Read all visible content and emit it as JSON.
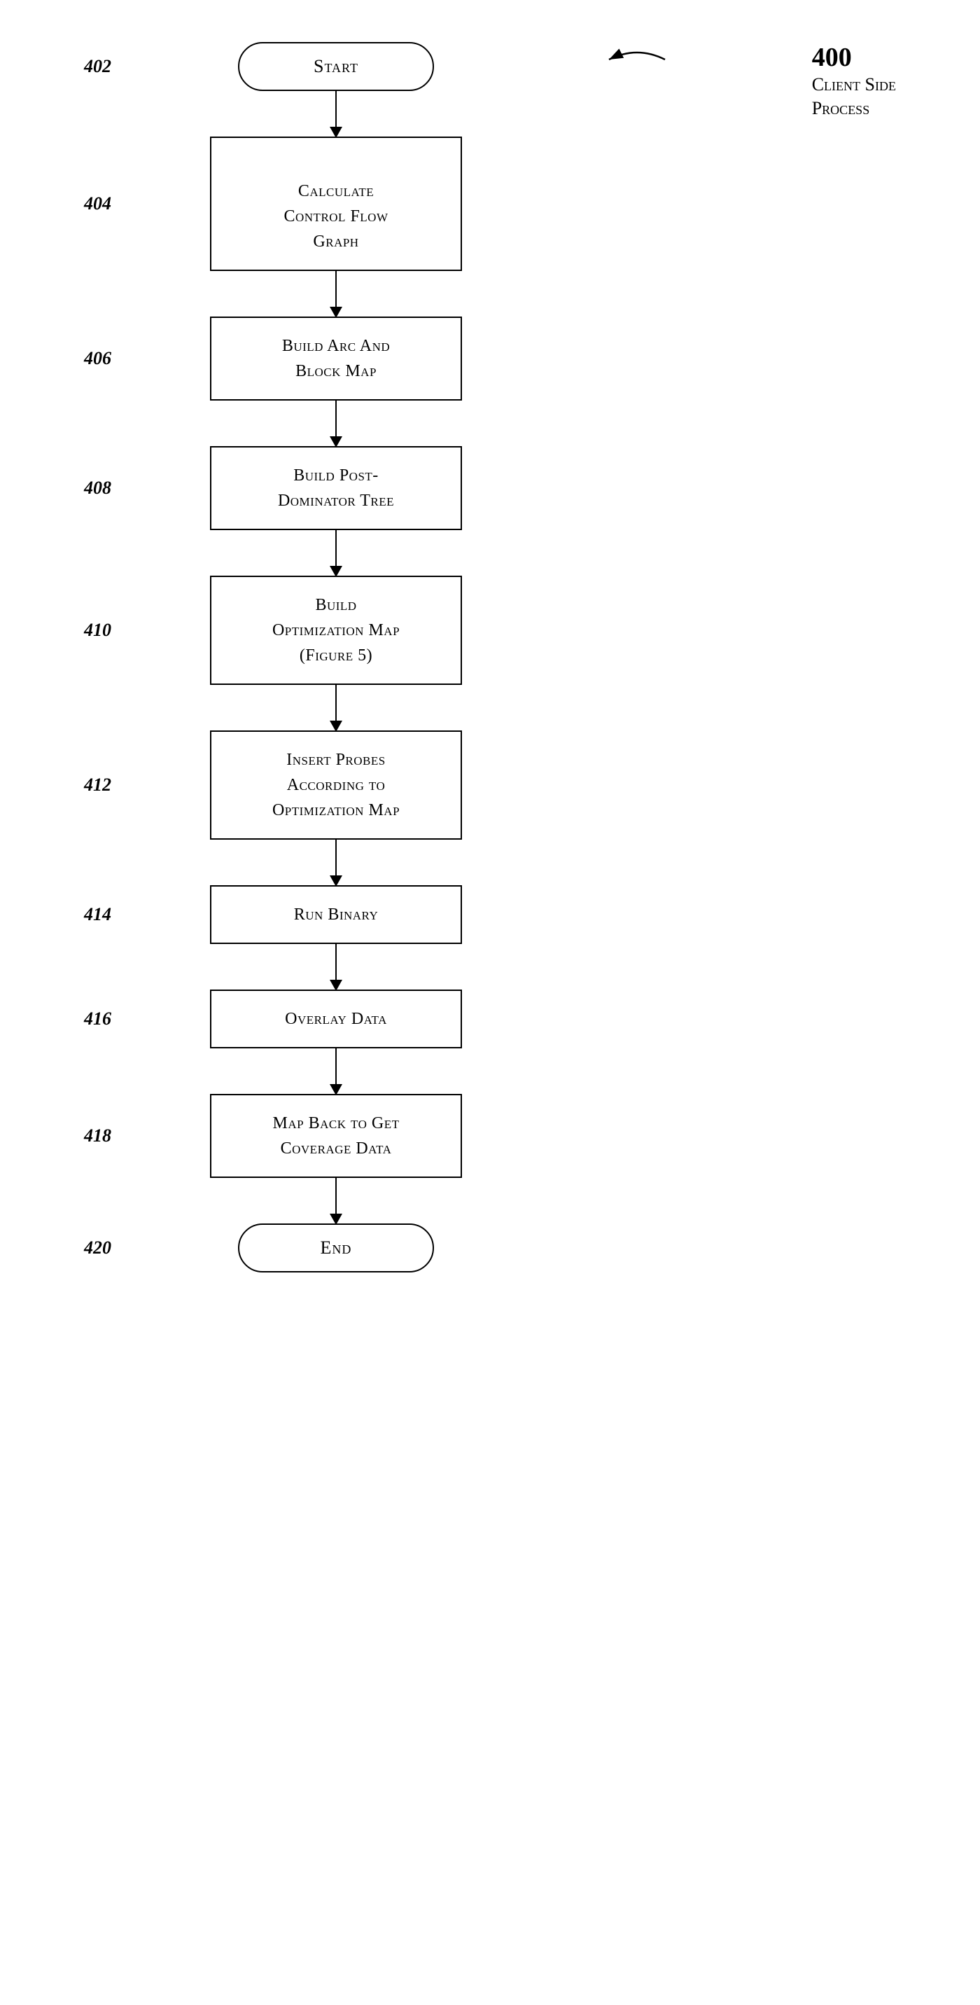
{
  "diagram": {
    "figure_number": "400",
    "figure_title_line1": "Client Side",
    "figure_title_line2": "Process",
    "nodes": [
      {
        "id": "start",
        "label": "Start",
        "type": "capsule",
        "step_num": "402"
      },
      {
        "id": "calc_cfg",
        "label": "Calculate\nControl Flow\nGraph",
        "type": "rect",
        "step_num": "404"
      },
      {
        "id": "build_arc",
        "label": "Build Arc And\nBlock Map",
        "type": "rect",
        "step_num": "406"
      },
      {
        "id": "build_post",
        "label": "Build Post-\nDominator Tree",
        "type": "rect",
        "step_num": "408"
      },
      {
        "id": "build_opt",
        "label": "Build\nOptimization Map\n(Figure 5)",
        "type": "rect",
        "step_num": "410"
      },
      {
        "id": "insert_probes",
        "label": "Insert Probes\nAccording to\nOptimization Map",
        "type": "rect",
        "step_num": "412"
      },
      {
        "id": "run_binary",
        "label": "Run Binary",
        "type": "rect",
        "step_num": "414"
      },
      {
        "id": "overlay_data",
        "label": "Overlay Data",
        "type": "rect",
        "step_num": "416"
      },
      {
        "id": "map_back",
        "label": "Map Back to Get\nCoverage Data",
        "type": "rect",
        "step_num": "418"
      },
      {
        "id": "end",
        "label": "End",
        "type": "capsule",
        "step_num": "420"
      }
    ],
    "arrow_heights": [
      60,
      55,
      55,
      55,
      55,
      55,
      55,
      55,
      55,
      55
    ]
  }
}
